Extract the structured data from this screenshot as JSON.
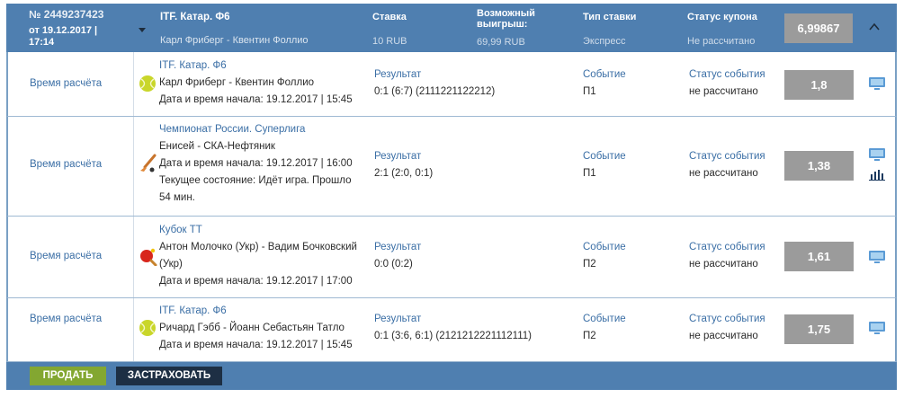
{
  "header": {
    "coupon_id": "№ 2449237423",
    "date": "от 19.12.2017 | 17:14",
    "title": "ITF. Катар. Ф6",
    "teams": "Карл Фриберг - Квентин Фоллио",
    "stake_label": "Ставка",
    "stake_value": "10 RUB",
    "win_label": "Возможный выигрыш:",
    "win_value": "69,99 RUB",
    "type_label": "Тип ставки",
    "type_value": "Экспресс",
    "status_label": "Статус купона",
    "status_value": "Не рассчитано",
    "total_odds": "6,99867"
  },
  "bets": [
    {
      "calc_label": "Время расчёта",
      "sport_icon": "tennis-ball-icon",
      "league": "ITF. Катар. Ф6",
      "lines": [
        "Карл Фриберг - Квентин Фоллио",
        "Дата и время начала: 19.12.2017 | 15:45"
      ],
      "result_label": "Результат",
      "result_value": "0:1 (6:7) (2111221122212)",
      "event_label": "Событие",
      "event_value": "П1",
      "status_label": "Статус события",
      "status_value": "не рассчитано",
      "odds": "1,8"
    },
    {
      "calc_label": "Время расчёта",
      "sport_icon": "hockey-stick-icon",
      "league": "Чемпионат России. Суперлига",
      "lines": [
        "Енисей - СКА-Нефтяник",
        "Дата и время начала: 19.12.2017 | 16:00",
        "Текущее состояние: Идёт игра. Прошло",
        "54 мин."
      ],
      "result_label": "Результат",
      "result_value": "2:1 (2:0, 0:1)",
      "event_label": "Событие",
      "event_value": "П1",
      "status_label": "Статус события",
      "status_value": "не рассчитано",
      "odds": "1,38"
    },
    {
      "calc_label": "Время расчёта",
      "sport_icon": "table-tennis-icon",
      "league": "Кубок ТТ",
      "lines": [
        "Антон Молочко (Укр) - Вадим Бочковский",
        "(Укр)",
        "Дата и время начала: 19.12.2017 | 17:00"
      ],
      "result_label": "Результат",
      "result_value": "0:0 (0:2)",
      "event_label": "Событие",
      "event_value": "П2",
      "status_label": "Статус события",
      "status_value": "не рассчитано",
      "odds": "1,61"
    },
    {
      "calc_label": "Время расчёта",
      "sport_icon": "tennis-ball-icon",
      "league": "ITF. Катар. Ф6",
      "lines": [
        "Ричард Гэбб - Йоанн Себастьян Татло",
        "Дата и время начала: 19.12.2017 | 15:45"
      ],
      "result_label": "Результат",
      "result_value": "0:1 (3:6, 6:1) (2121212221112111)",
      "event_label": "Событие",
      "event_value": "П2",
      "status_label": "Статус события",
      "status_value": "не рассчитано",
      "odds": "1,75"
    }
  ],
  "footer": {
    "sell_label": "ПРОДАТЬ",
    "insure_label": "ЗАСТРАХОВАТЬ"
  },
  "colors": {
    "header_bg": "#4f7fb0",
    "odds_box": "#9b9b9b",
    "link_blue": "#3a6ea5",
    "sell_green": "#83a731",
    "insure_navy": "#1d2f44"
  }
}
